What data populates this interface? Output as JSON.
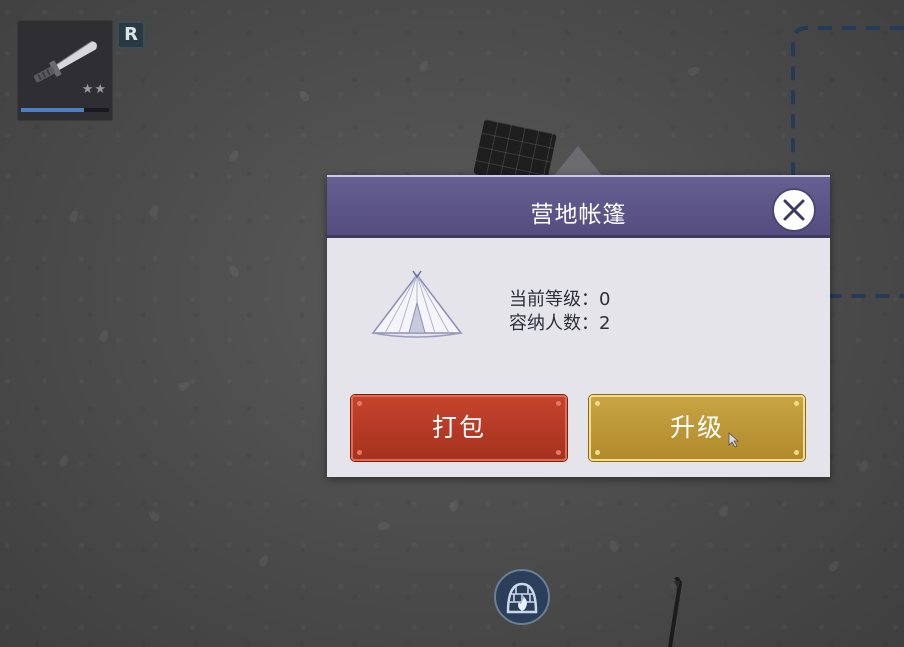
{
  "weapon_slot": {
    "icon": "combat-knife-icon",
    "stars": "★★",
    "rarity": "R",
    "durability_fraction": 0.72
  },
  "dialog": {
    "title": "营地帐篷",
    "close_icon": "close-icon",
    "item_icon": "tent-icon",
    "stats": [
      {
        "label": "当前等级：",
        "value": "0"
      },
      {
        "label": "容纳人数：",
        "value": "2"
      }
    ],
    "pack_label": "打包",
    "upgrade_label": "升级"
  },
  "hud": {
    "campfire_icon": "campfire-icon"
  },
  "colors": {
    "header": "#5d568a",
    "pack_button": "#b63a25",
    "upgrade_button": "#bf9a3a",
    "boundary_dash": "#243a55"
  }
}
